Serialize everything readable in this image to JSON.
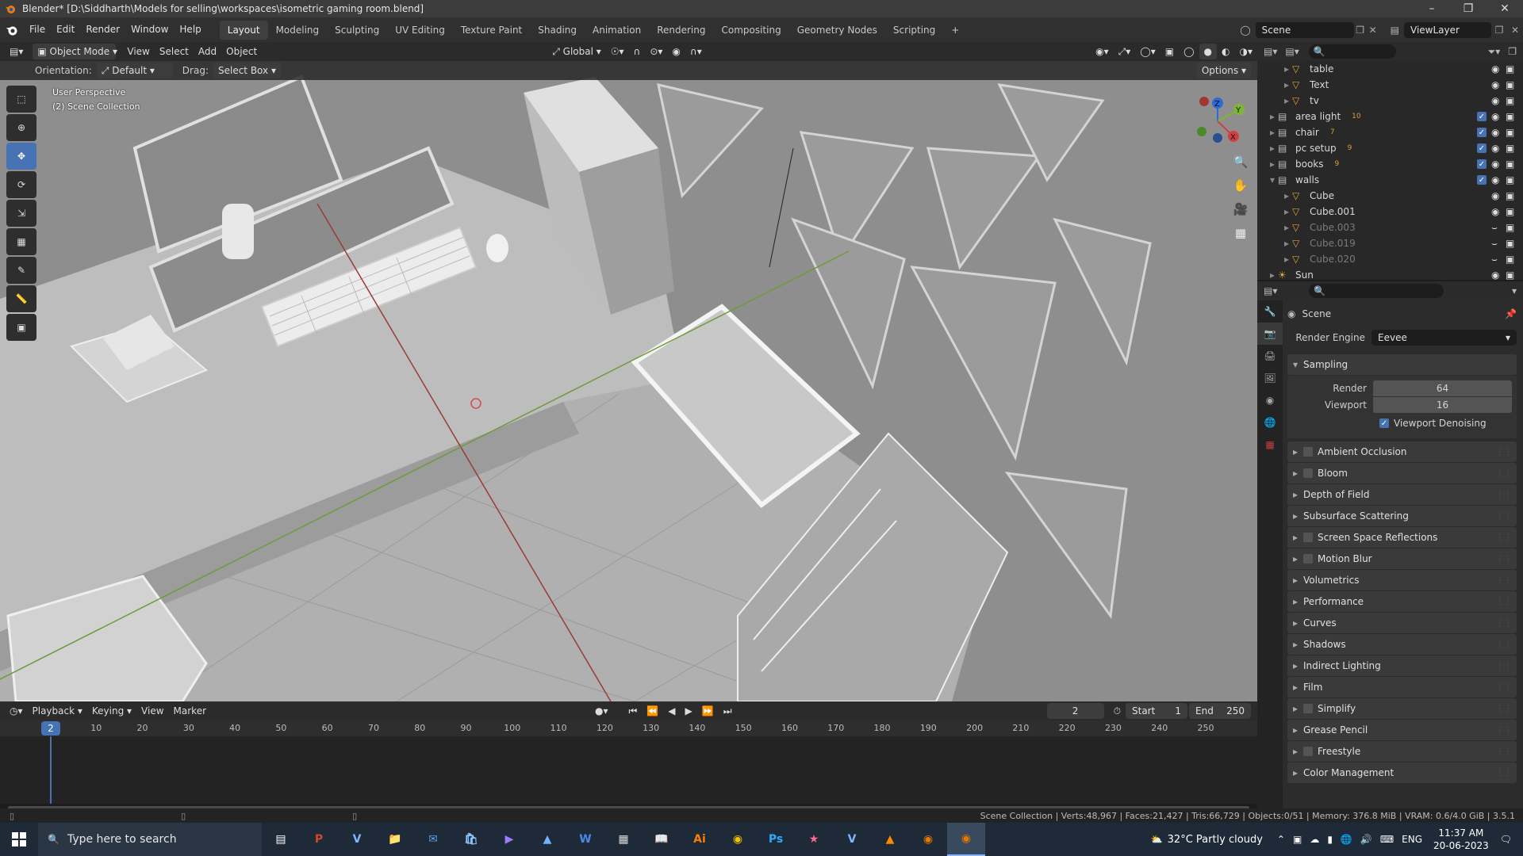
{
  "window": {
    "title": "Blender* [D:\\Siddharth\\Models for selling\\workspaces\\isometric gaming room.blend]"
  },
  "menu": {
    "items": [
      "File",
      "Edit",
      "Render",
      "Window",
      "Help"
    ]
  },
  "workspaces": [
    "Layout",
    "Modeling",
    "Sculpting",
    "UV Editing",
    "Texture Paint",
    "Shading",
    "Animation",
    "Rendering",
    "Compositing",
    "Geometry Nodes",
    "Scripting"
  ],
  "active_workspace": "Layout",
  "scene": {
    "name": "Scene",
    "view_layer": "ViewLayer"
  },
  "viewport_header": {
    "mode": "Object Mode",
    "menus": [
      "View",
      "Select",
      "Add",
      "Object"
    ],
    "transform": "Global",
    "options": "Options"
  },
  "tool_settings": {
    "orientation_label": "Orientation:",
    "orientation": "Default",
    "drag_label": "Drag:",
    "drag": "Select Box"
  },
  "viewport": {
    "perspective": "User Perspective",
    "collection": "(2) Scene Collection"
  },
  "gizmo": {
    "z": "Z",
    "y": "Y",
    "x": "X"
  },
  "outliner": {
    "items": [
      {
        "name": "table",
        "icon": "mesh-icon",
        "indent": 2,
        "badge": "",
        "dim": false,
        "checkbox": false
      },
      {
        "name": "Text",
        "icon": "mesh-icon",
        "indent": 2,
        "badge": "",
        "dim": false,
        "checkbox": false
      },
      {
        "name": "tv",
        "icon": "mesh-icon",
        "indent": 2,
        "badge": "",
        "dim": false,
        "checkbox": false
      },
      {
        "name": "area light",
        "icon": "collection-icon",
        "indent": 1,
        "badge": "10",
        "dim": false,
        "checkbox": true
      },
      {
        "name": "chair",
        "icon": "collection-icon",
        "indent": 1,
        "badge": "7",
        "dim": false,
        "checkbox": true
      },
      {
        "name": "pc setup",
        "icon": "collection-icon",
        "indent": 1,
        "badge": "9",
        "dim": false,
        "checkbox": true
      },
      {
        "name": "books",
        "icon": "collection-icon",
        "indent": 1,
        "badge": "9",
        "dim": false,
        "checkbox": true
      },
      {
        "name": "walls",
        "icon": "collection-icon",
        "indent": 1,
        "badge": "",
        "dim": false,
        "checkbox": true
      },
      {
        "name": "Cube",
        "icon": "mesh-icon",
        "indent": 2,
        "badge": "",
        "dim": false,
        "checkbox": false
      },
      {
        "name": "Cube.001",
        "icon": "mesh-icon",
        "indent": 2,
        "badge": "",
        "dim": false,
        "checkbox": false
      },
      {
        "name": "Cube.003",
        "icon": "mesh-icon",
        "indent": 2,
        "badge": "",
        "dim": true,
        "checkbox": false
      },
      {
        "name": "Cube.019",
        "icon": "mesh-icon",
        "indent": 2,
        "badge": "",
        "dim": true,
        "checkbox": false
      },
      {
        "name": "Cube.020",
        "icon": "mesh-icon",
        "indent": 2,
        "badge": "",
        "dim": true,
        "checkbox": false
      },
      {
        "name": "Sun",
        "icon": "light-icon",
        "indent": 1,
        "badge": "",
        "dim": false,
        "checkbox": false
      }
    ]
  },
  "properties": {
    "context": "Scene",
    "render_engine_label": "Render Engine",
    "render_engine": "Eevee",
    "sampling": {
      "label": "Sampling",
      "render_label": "Render",
      "render": "64",
      "viewport_label": "Viewport",
      "viewport": "16",
      "denoise": "Viewport Denoising"
    },
    "panels": [
      {
        "label": "Ambient Occlusion",
        "checkbox": true
      },
      {
        "label": "Bloom",
        "checkbox": true
      },
      {
        "label": "Depth of Field",
        "checkbox": false
      },
      {
        "label": "Subsurface Scattering",
        "checkbox": false
      },
      {
        "label": "Screen Space Reflections",
        "checkbox": true
      },
      {
        "label": "Motion Blur",
        "checkbox": true
      },
      {
        "label": "Volumetrics",
        "checkbox": false
      },
      {
        "label": "Performance",
        "checkbox": false
      },
      {
        "label": "Curves",
        "checkbox": false
      },
      {
        "label": "Shadows",
        "checkbox": false
      },
      {
        "label": "Indirect Lighting",
        "checkbox": false
      },
      {
        "label": "Film",
        "checkbox": false
      },
      {
        "label": "Simplify",
        "checkbox": true
      },
      {
        "label": "Grease Pencil",
        "checkbox": false
      },
      {
        "label": "Freestyle",
        "checkbox": true
      },
      {
        "label": "Color Management",
        "checkbox": false
      }
    ]
  },
  "timeline": {
    "menus": [
      "Playback",
      "Keying",
      "View",
      "Marker"
    ],
    "current_frame": "2",
    "start_label": "Start",
    "start": "1",
    "end_label": "End",
    "end": "250",
    "ticks": [
      "10",
      "20",
      "30",
      "40",
      "50",
      "60",
      "70",
      "80",
      "90",
      "100",
      "110",
      "120",
      "130",
      "140",
      "150",
      "160",
      "170",
      "180",
      "190",
      "200",
      "210",
      "220",
      "230",
      "240",
      "250"
    ]
  },
  "status": {
    "text": "Scene Collection | Verts:48,967 | Faces:21,427 | Tris:66,729 | Objects:0/51 | Memory: 376.8 MiB | VRAM: 0.6/4.0 GiB | 3.5.1"
  },
  "taskbar": {
    "search_placeholder": "Type here to search",
    "weather": "32°C  Partly cloudy",
    "lang": "ENG",
    "time": "11:37 AM",
    "date": "20-06-2023"
  }
}
